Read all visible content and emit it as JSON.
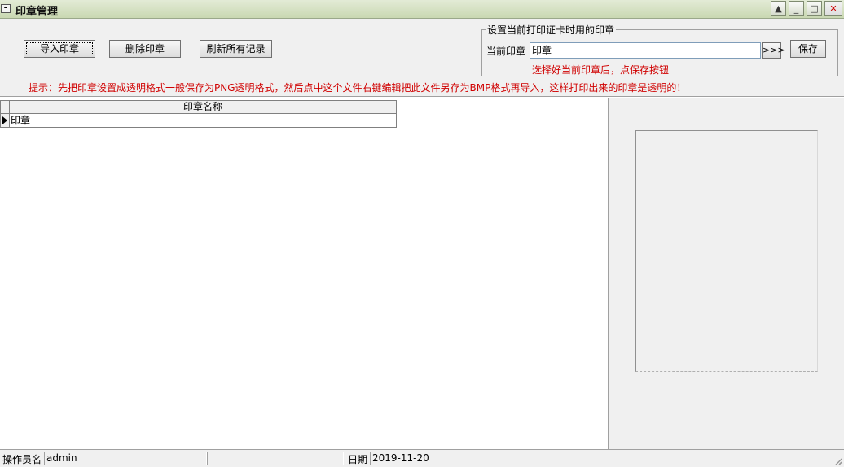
{
  "window": {
    "title": "印章管理",
    "sysmenu_icon": "minus-icon",
    "controls": {
      "minimize": "minimize-icon",
      "maximize": "maximize-icon",
      "close": "close-icon",
      "restore": "restore-icon"
    }
  },
  "toolbar": {
    "import_label": "导入印章",
    "delete_label": "删除印章",
    "refresh_label": "刷新所有记录"
  },
  "settings": {
    "group_label": "设置当前打印证卡时用的印章",
    "current_label": "当前印章",
    "current_value": "印章",
    "browse_label": ">>>",
    "save_label": "保存",
    "hint": "选择好当前印章后，点保存按钮"
  },
  "tip": "提示：先把印章设置成透明格式一般保存为PNG透明格式，然后点中这个文件右键编辑把此文件另存为BMP格式再导入，这样打印出来的印章是透明的！",
  "grid": {
    "column_header": "印章名称",
    "rows": [
      "印章"
    ]
  },
  "status": {
    "operator_label": "操作员名",
    "operator_value": "admin",
    "date_label": "日期",
    "date_value": "2019-11-20"
  },
  "colors": {
    "hint_red": "#d00000",
    "title_bar": "#d6e2c4"
  }
}
